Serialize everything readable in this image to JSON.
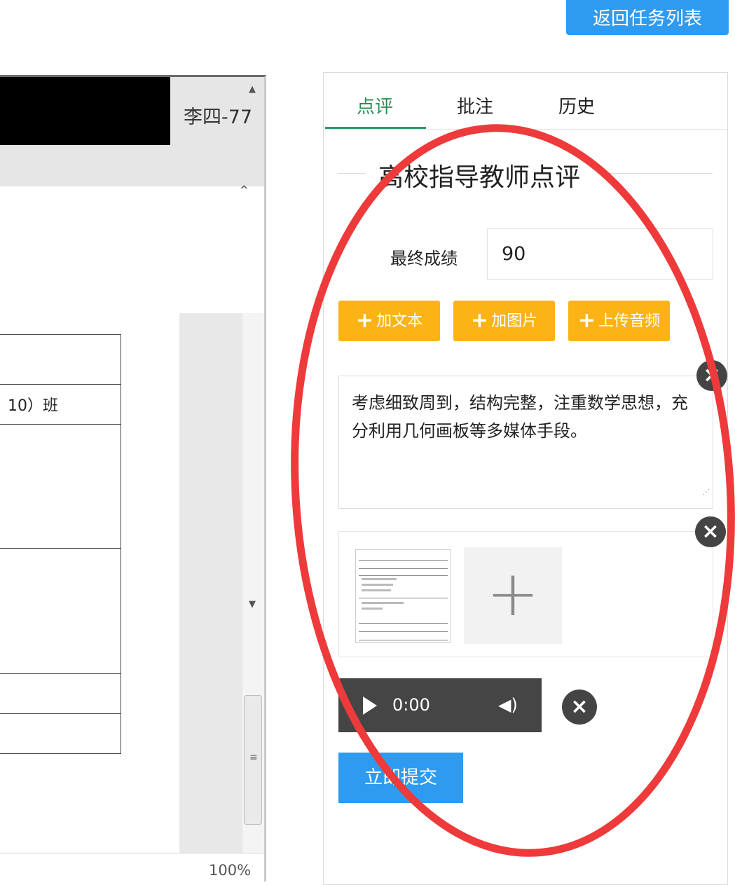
{
  "header": {
    "return_label": "返回任务列表"
  },
  "viewer": {
    "name_label": "李四-77",
    "rows": [
      "",
      "10）班",
      "",
      "",
      "",
      ""
    ],
    "zoom": "100%",
    "scroll_up": "▲",
    "scroll_down": "▼",
    "collapse": "⌃",
    "grip": "≡"
  },
  "panel": {
    "tabs": [
      {
        "label": "点评",
        "active": true
      },
      {
        "label": "批注",
        "active": false
      },
      {
        "label": "历史",
        "active": false
      }
    ],
    "section_title": "高校指导教师点评",
    "score": {
      "label": "最终成绩",
      "value": "90"
    },
    "buttons": {
      "add_text": "加文本",
      "add_image": "加图片",
      "upload_audio": "上传音频",
      "submit": "立即提交"
    },
    "comment_text": "考虑细致周到，结构完整，注重数学思想，充分利用几何画板等多媒体手段。",
    "audio": {
      "time": "0:00"
    }
  },
  "colors": {
    "primary": "#2e9bf0",
    "warning": "#fbb316",
    "active_tab": "#2e8b57",
    "annotation": "#ee3a3a"
  },
  "icons": [
    "plus-icon",
    "close-icon",
    "play-icon",
    "volume-icon"
  ]
}
